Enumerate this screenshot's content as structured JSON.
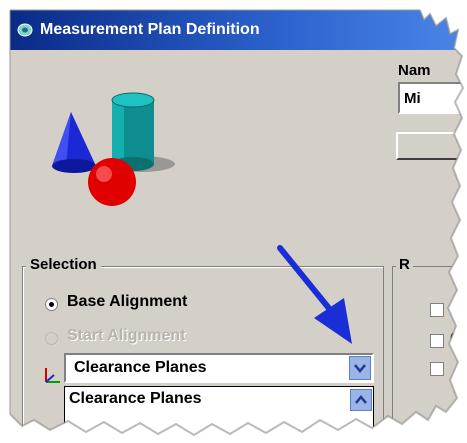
{
  "window": {
    "title": "Measurement Plan Definition"
  },
  "right_panel": {
    "name_label": "Nam",
    "name_value": "Mi",
    "group_label": "R",
    "checkbox2_label": "G"
  },
  "selection": {
    "title": "Selection",
    "base_alignment": "Base Alignment",
    "start_alignment": "Start Alignment",
    "combo_value": "Clearance Planes",
    "list_first": "Clearance Planes"
  },
  "colors": {
    "title_blue": "#0a2a86",
    "arrow_blue": "#1a2ed8",
    "face": "#d4d0c8"
  },
  "icons": [
    "app-icon",
    "3d-shapes-icon",
    "axis-icon",
    "dropdown-arrow-icon",
    "scroll-up-icon",
    "annotation-arrow-icon"
  ]
}
